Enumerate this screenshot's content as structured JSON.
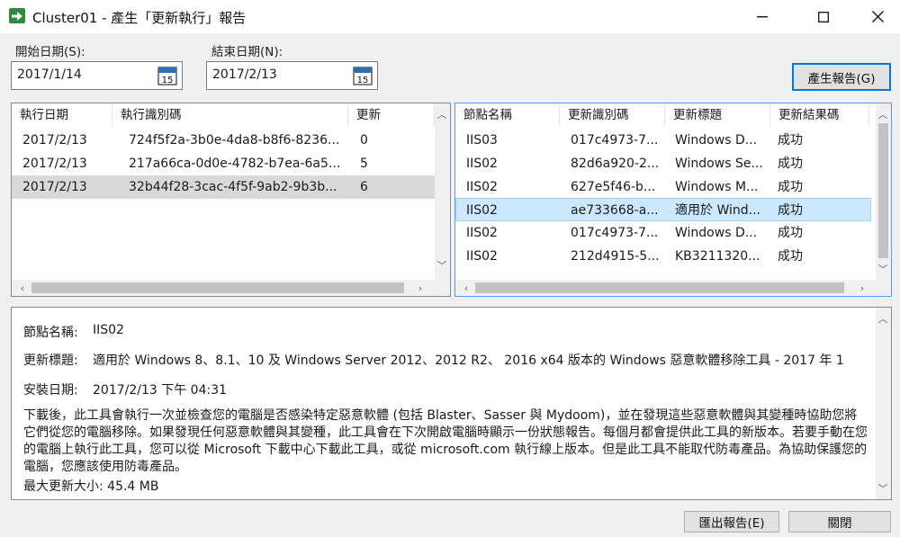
{
  "window": {
    "title": "Cluster01 - 產生「更新執行」報告",
    "minimize_glyph": "—",
    "maximize_glyph": "☐",
    "close_glyph": "✕"
  },
  "filters": {
    "start_label": "開始日期(S):",
    "start_value": "2017/1/14",
    "end_label": "結束日期(N):",
    "end_value": "2017/2/13",
    "calendar_day": "15",
    "generate_button": "產生報告(G)"
  },
  "runs": {
    "columns": [
      "執行日期",
      "執行識別碼",
      "更新"
    ],
    "rows": [
      {
        "date": "2017/2/13",
        "id": "724f5f2a-3b0e-4da8-b8f6-8236...",
        "updates": "0"
      },
      {
        "date": "2017/2/13",
        "id": "217a66ca-0d0e-4782-b7ea-6a5...",
        "updates": "5"
      },
      {
        "date": "2017/2/13",
        "id": "32b44f28-3cac-4f5f-9ab2-9b3b...",
        "updates": "6"
      }
    ]
  },
  "updates": {
    "columns": [
      "節點名稱",
      "更新識別碼",
      "更新標題",
      "更新結果碼"
    ],
    "rows": [
      {
        "node": "IIS03",
        "id": "017c4973-7...",
        "title": "Windows D...",
        "result": "成功"
      },
      {
        "node": "IIS02",
        "id": "82d6a920-2...",
        "title": "Windows Se...",
        "result": "成功"
      },
      {
        "node": "IIS02",
        "id": "627e5f46-b...",
        "title": "Windows M...",
        "result": "成功"
      },
      {
        "node": "IIS02",
        "id": "ae733668-a...",
        "title": "適用於 Wind...",
        "result": "成功"
      },
      {
        "node": "IIS02",
        "id": "017c4973-7...",
        "title": "Windows D...",
        "result": "成功"
      },
      {
        "node": "IIS02",
        "id": "212d4915-5...",
        "title": "KB3211320...",
        "result": "成功"
      }
    ]
  },
  "details": {
    "node_label": "節點名稱:",
    "node_value": "IIS02",
    "title_label": "更新標題:",
    "title_value": "適用於 Windows 8、8.1、10 及 Windows Server 2012、2012 R2、 2016 x64 版本的 Windows 惡意軟體移除工具 - 2017 年 1",
    "install_label": "安裝日期:",
    "install_value": "2017/2/13 下午 04:31",
    "description": "下載後，此工具會執行一次並檢查您的電腦是否感染特定惡意軟體 (包括 Blaster、Sasser 與 Mydoom)，並在發現這些惡意軟體與其變種時協助您將它們從您的電腦移除。如果發現任何惡意軟體與其變種，此工具會在下次開啟電腦時顯示一份狀態報告。每個月都會提供此工具的新版本。若要手動在您的電腦上執行此工具，您可以從 Microsoft 下載中心下載此工具，或從 microsoft.com 執行線上版本。但是此工具不能取代防毒產品。為協助保護您的電腦，您應該使用防毒產品。",
    "max_size": "最大更新大小: 45.4 MB"
  },
  "footer": {
    "export_button": "匯出報告(E)",
    "close_button": "關閉"
  },
  "colors": {
    "accent": "#0078d7",
    "selection_blue": "#cce8ff",
    "selection_gray": "#d9d9d9",
    "app_icon_green": "#2f8a3b"
  }
}
